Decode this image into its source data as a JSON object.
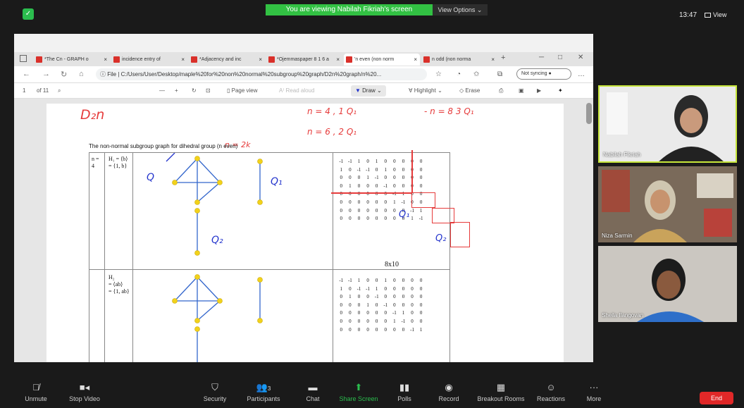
{
  "top": {
    "banner": "You are viewing Nabilah Fikriah's screen",
    "view_options": "View Options ⌄",
    "clock": "13:47",
    "view": "View"
  },
  "browser": {
    "tabs": [
      {
        "label": "*The Cn - GRAPH o"
      },
      {
        "label": "incidence entry of"
      },
      {
        "label": "*Adjacency and inc"
      },
      {
        "label": "*Ojemmaspaper 8 1 6 a"
      },
      {
        "label": "'n even (non norm"
      },
      {
        "label": "n odd (non norma"
      }
    ],
    "url_prefix": "File",
    "url": "C:/Users/User/Desktop/maple%20for%20non%20normal%20subgroup%20graph/D2n%20graph/n%20...",
    "sync": "Not syncing",
    "page_num": "1",
    "page_total": "of 11",
    "page_view": "Page view",
    "read_aloud": "Read aloud",
    "draw": "Draw",
    "highlight": "Highlight",
    "erase": "Erase"
  },
  "doc": {
    "caption": "The non-normal subgroup graph for dihedral group (n even)",
    "col1": "n = 4",
    "row1_label": [
      "H₁ = ⟨b⟩",
      "= {1, b}"
    ],
    "row2_label": [
      "H₂",
      "= ⟨ab⟩",
      "= {1, ab}"
    ],
    "matrix1": [
      [
        "-1",
        "-1",
        "1",
        "0",
        "1",
        "0",
        "0",
        "0",
        "0",
        "0"
      ],
      [
        "1",
        "0",
        "-1",
        "-1",
        "0",
        "1",
        "0",
        "0",
        "0",
        "0"
      ],
      [
        "0",
        "0",
        "0",
        "1",
        "-1",
        "0",
        "0",
        "0",
        "0",
        "0"
      ],
      [
        "0",
        "1",
        "0",
        "0",
        "0",
        "-1",
        "0",
        "0",
        "0",
        "0"
      ],
      [
        "0",
        "0",
        "0",
        "0",
        "0",
        "0",
        "-1",
        "1",
        "0",
        "0"
      ],
      [
        "0",
        "0",
        "0",
        "0",
        "0",
        "0",
        "1",
        "-1",
        "0",
        "0"
      ],
      [
        "0",
        "0",
        "0",
        "0",
        "0",
        "0",
        "0",
        "0",
        "-1",
        "1"
      ],
      [
        "0",
        "0",
        "0",
        "0",
        "0",
        "0",
        "0",
        "0",
        "1",
        "-1"
      ]
    ],
    "matrix_dim": "8x10",
    "matrix2": [
      [
        "-1",
        "-1",
        "1",
        "0",
        "0",
        "1",
        "0",
        "0",
        "0",
        "0"
      ],
      [
        "1",
        "0",
        "-1",
        "-1",
        "1",
        "0",
        "0",
        "0",
        "0",
        "0"
      ],
      [
        "0",
        "1",
        "0",
        "0",
        "-1",
        "0",
        "0",
        "0",
        "0",
        "0"
      ],
      [
        "0",
        "0",
        "0",
        "1",
        "0",
        "-1",
        "0",
        "0",
        "0",
        "0"
      ],
      [
        "0",
        "0",
        "0",
        "0",
        "0",
        "0",
        "-1",
        "1",
        "0",
        "0"
      ],
      [
        "0",
        "0",
        "0",
        "0",
        "0",
        "0",
        "1",
        "-1",
        "0",
        "0"
      ],
      [
        "0",
        "0",
        "0",
        "0",
        "0",
        "0",
        "0",
        "0",
        "-1",
        "1"
      ]
    ]
  },
  "annotations": {
    "d2n": "D₂n",
    "n2k": "n = 2k",
    "n4": "n = 4 ,  1 Q₁",
    "n8": "- n = 8    3 Q₁",
    "n6": "n = 6 ,  2 Q₁",
    "q": "Q",
    "q1": "Q₁",
    "q2": "Q₂",
    "q1b": "Q₁",
    "q2b": "Q₂"
  },
  "participants": [
    {
      "name": "Nabilah Fikriah"
    },
    {
      "name": "Niza Sarmin"
    },
    {
      "name": "Sheila Ilangovan"
    }
  ],
  "bottom": [
    {
      "label": "Unmute",
      "icon": "microphone-muted-icon"
    },
    {
      "label": "Stop Video",
      "icon": "video-camera-icon"
    },
    {
      "label": "Security",
      "icon": "shield-icon"
    },
    {
      "label": "Participants",
      "icon": "participants-icon",
      "count": "3"
    },
    {
      "label": "Chat",
      "icon": "chat-icon"
    },
    {
      "label": "Share Screen",
      "icon": "share-screen-icon"
    },
    {
      "label": "Polls",
      "icon": "polls-icon"
    },
    {
      "label": "Record",
      "icon": "record-icon"
    },
    {
      "label": "Breakout Rooms",
      "icon": "breakout-rooms-icon"
    },
    {
      "label": "Reactions",
      "icon": "reactions-icon"
    },
    {
      "label": "More",
      "icon": "more-icon"
    }
  ],
  "end": "End",
  "colors": {
    "zoom_green": "#32c143",
    "end_red": "#e02828",
    "ink_blue": "#2233cc",
    "ink_red": "#e63b3b",
    "graph_yellow": "#f2d21a"
  }
}
